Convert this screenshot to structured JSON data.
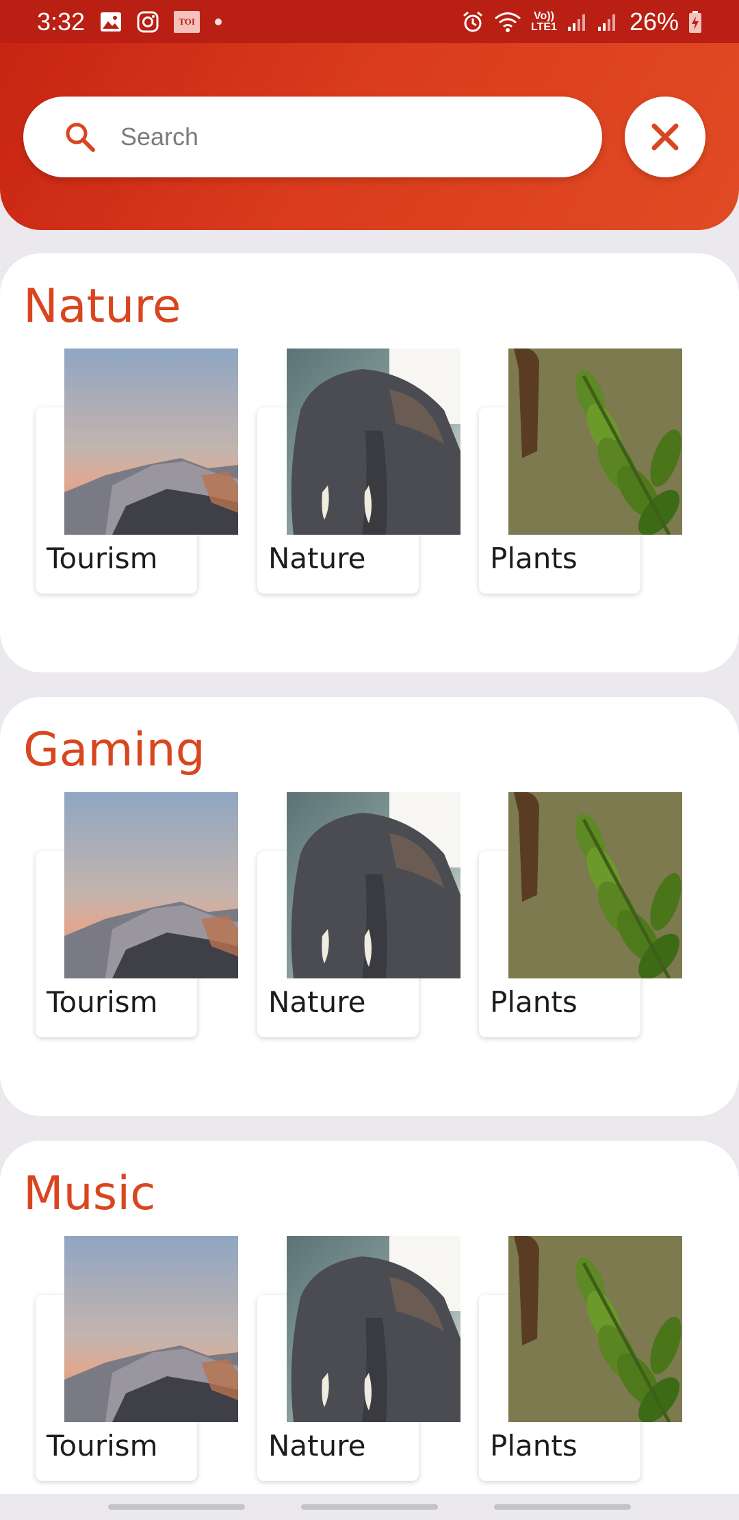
{
  "status_bar": {
    "time": "3:32",
    "left_icons": [
      "gallery-icon",
      "instagram-icon",
      "toi-icon",
      "dot-icon"
    ],
    "toi_label": "TOI",
    "lte_top": "Vo))",
    "lte_bottom": "LTE1",
    "battery": "26%",
    "right_icons": [
      "alarm-icon",
      "wifi-icon",
      "signal-icon",
      "signal-icon",
      "battery-charging-icon"
    ]
  },
  "search": {
    "placeholder": "Search",
    "value": ""
  },
  "colors": {
    "header": "#c82413",
    "accent": "#d8461f",
    "background": "#ebe9ed"
  },
  "sections": [
    {
      "title": "Nature",
      "cards": [
        {
          "label": "Tourism",
          "image": "mountain-image"
        },
        {
          "label": "Nature",
          "image": "elephant-image"
        },
        {
          "label": "Plants",
          "image": "plant-image"
        }
      ]
    },
    {
      "title": "Gaming",
      "cards": [
        {
          "label": "Tourism",
          "image": "mountain-image"
        },
        {
          "label": "Nature",
          "image": "elephant-image"
        },
        {
          "label": "Plants",
          "image": "plant-image"
        }
      ]
    },
    {
      "title": "Music",
      "cards": [
        {
          "label": "Tourism",
          "image": "mountain-image"
        },
        {
          "label": "Nature",
          "image": "elephant-image"
        },
        {
          "label": "Plants",
          "image": "plant-image"
        }
      ]
    }
  ]
}
